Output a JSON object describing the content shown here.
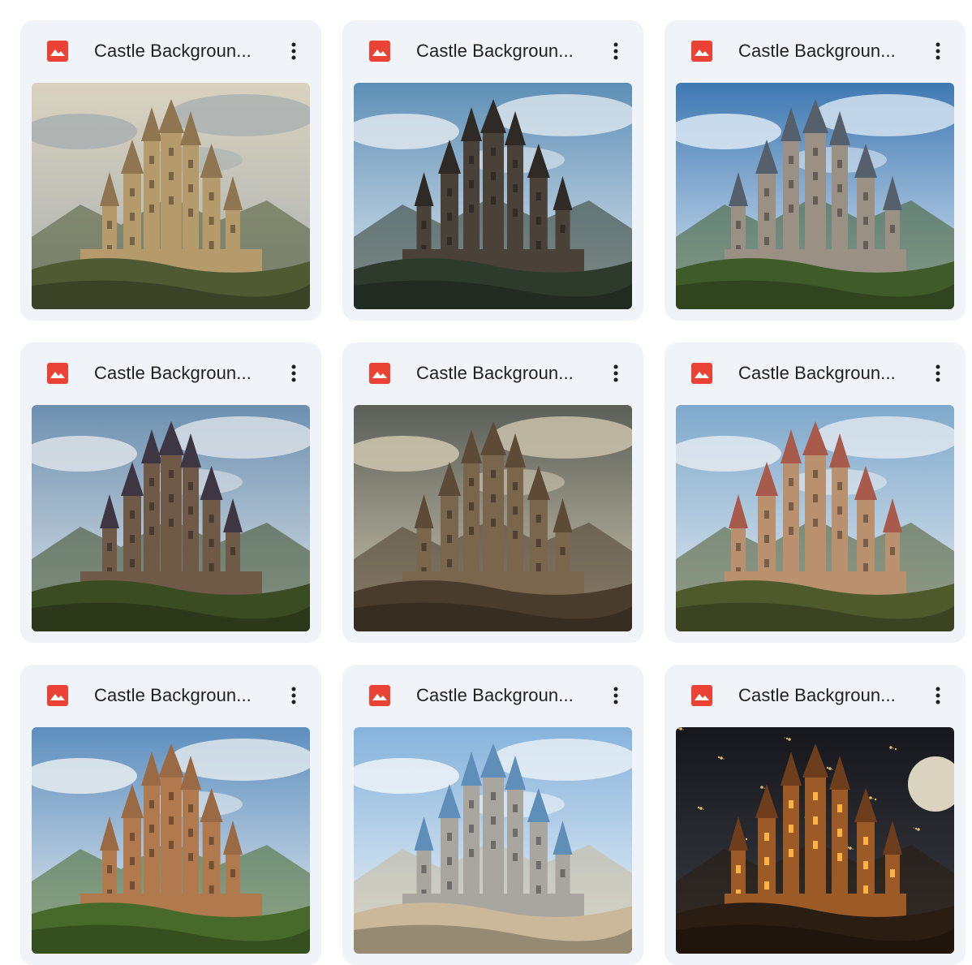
{
  "files": [
    {
      "title": "Castle Backgroun...",
      "thumbnail": "castle-on-cliff-golden",
      "palette": {
        "sky": "#d9d2bf",
        "sky2": "#a9b0b1",
        "land": "#4f5a33",
        "castle": "#b59a6b",
        "roof": "#8f7550"
      }
    },
    {
      "title": "Castle Backgroun...",
      "thumbnail": "dark-castle-mountains-lake",
      "palette": {
        "sky": "#5e8fb6",
        "sky2": "#dfe8ef",
        "land": "#2d3a2c",
        "castle": "#4a4238",
        "roof": "#2f2a26"
      }
    },
    {
      "title": "Castle Backgroun...",
      "thumbnail": "castle-green-island",
      "palette": {
        "sky": "#3f79b3",
        "sky2": "#dbe7f3",
        "land": "#3f5b2a",
        "castle": "#9a9184",
        "roof": "#55606c"
      }
    },
    {
      "title": "Castle Backgroun...",
      "thumbnail": "coastal-castle-cliff-sea",
      "palette": {
        "sky": "#6d90b0",
        "sky2": "#dde3e8",
        "land": "#3b4b22",
        "castle": "#6f5a48",
        "roof": "#3e3642"
      }
    },
    {
      "title": "Castle Backgroun...",
      "thumbnail": "stone-fortress-stormy-sky",
      "palette": {
        "sky": "#5b5f58",
        "sky2": "#cfc7b0",
        "land": "#4a3c2c",
        "castle": "#7a654d",
        "roof": "#5d4b38"
      }
    },
    {
      "title": "Castle Backgroun...",
      "thumbnail": "fairytale-castle-red-roofs",
      "palette": {
        "sky": "#7fa9cc",
        "sky2": "#e3eaf0",
        "land": "#4f5a2c",
        "castle": "#b9916e",
        "roof": "#a85b4a"
      }
    },
    {
      "title": "Castle Backgroun...",
      "thumbnail": "golden-castle-green-trees",
      "palette": {
        "sky": "#5e8fbf",
        "sky2": "#e6ecef",
        "land": "#476a2a",
        "castle": "#b07a4e",
        "roof": "#9a6a45"
      }
    },
    {
      "title": "Castle Backgroun...",
      "thumbnail": "blue-spire-castle-sky",
      "palette": {
        "sky": "#86b3dc",
        "sky2": "#eef3f7",
        "land": "#c9b99a",
        "castle": "#a9a6a0",
        "roof": "#5f8fb8"
      }
    },
    {
      "title": "Castle Backgroun...",
      "thumbnail": "night-castle-moon-lights",
      "palette": {
        "sky": "#15171c",
        "sky2": "#3b3d44",
        "land": "#2a1d12",
        "castle": "#9b5a26",
        "roof": "#6e3e1c"
      }
    }
  ],
  "icons": {
    "file_type": "image-file-icon",
    "menu": "more-vert-icon"
  },
  "colors": {
    "file_icon_red": "#ea4335",
    "card_bg": "#f0f4f9",
    "text": "#1f1f1f"
  }
}
